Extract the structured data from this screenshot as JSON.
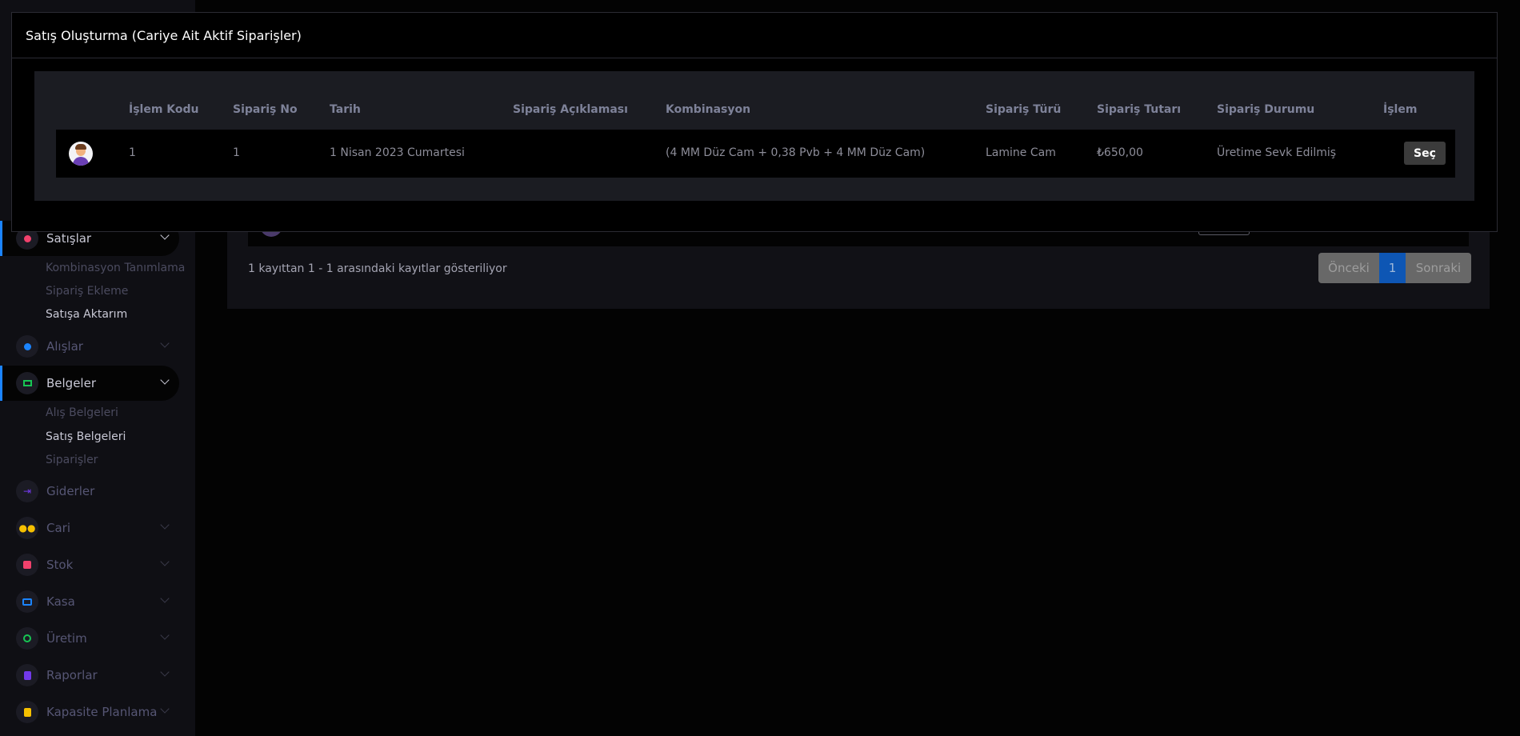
{
  "sidebar": {
    "items": [
      {
        "label": "Satışlar",
        "icon": "red-circle-icon",
        "color": "#f1416c"
      },
      {
        "label": "Alışlar",
        "icon": "blue-circle-icon",
        "color": "#1b84ff"
      },
      {
        "label": "Belgeler",
        "icon": "book-icon",
        "color": "#17c653"
      },
      {
        "label": "Giderler",
        "icon": "arrow-right-icon",
        "color": "#7239ea"
      },
      {
        "label": "Cari",
        "icon": "people-icon",
        "color": "#f6c000"
      },
      {
        "label": "Stok",
        "icon": "box-icon",
        "color": "#f1416c"
      },
      {
        "label": "Kasa",
        "icon": "wallet-icon",
        "color": "#1b84ff"
      },
      {
        "label": "Üretim",
        "icon": "factory-icon",
        "color": "#17c653"
      },
      {
        "label": "Raporlar",
        "icon": "report-icon",
        "color": "#7239ea"
      },
      {
        "label": "Kapasite Planlama",
        "icon": "clipboard-icon",
        "color": "#f6c000"
      }
    ],
    "sales_sub": [
      "Kombinasyon Tanımlama",
      "Sipariş Ekleme",
      "Satışa Aktarım"
    ],
    "docs_sub": [
      "Alış Belgeleri",
      "Satış Belgeleri",
      "Siparişler"
    ]
  },
  "background": {
    "info": "1 kayıttan 1 - 1 arasındaki kayıtlar gösteriliyor",
    "pager": {
      "prev": "Önceki",
      "page": "1",
      "next": "Sonraki"
    }
  },
  "modal": {
    "title": "Satış Oluşturma (Cariye Ait Aktif Siparişler)",
    "columns": [
      "İşlem Kodu",
      "Sipariş No",
      "Tarih",
      "Sipariş Açıklaması",
      "Kombinasyon",
      "Sipariş Türü",
      "Sipariş Tutarı",
      "Sipariş Durumu",
      "İşlem"
    ],
    "rows": [
      {
        "islem_kodu": "1",
        "siparis_no": "1",
        "tarih": "1 Nisan 2023 Cumartesi",
        "aciklama": "",
        "kombinasyon": "(4 MM Düz Cam + 0,38 Pvb + 4 MM Düz Cam)",
        "tur": "Lamine Cam",
        "tutar": "₺650,00",
        "durum": "Üretime Sevk Edilmiş",
        "action": "Seç"
      }
    ]
  }
}
